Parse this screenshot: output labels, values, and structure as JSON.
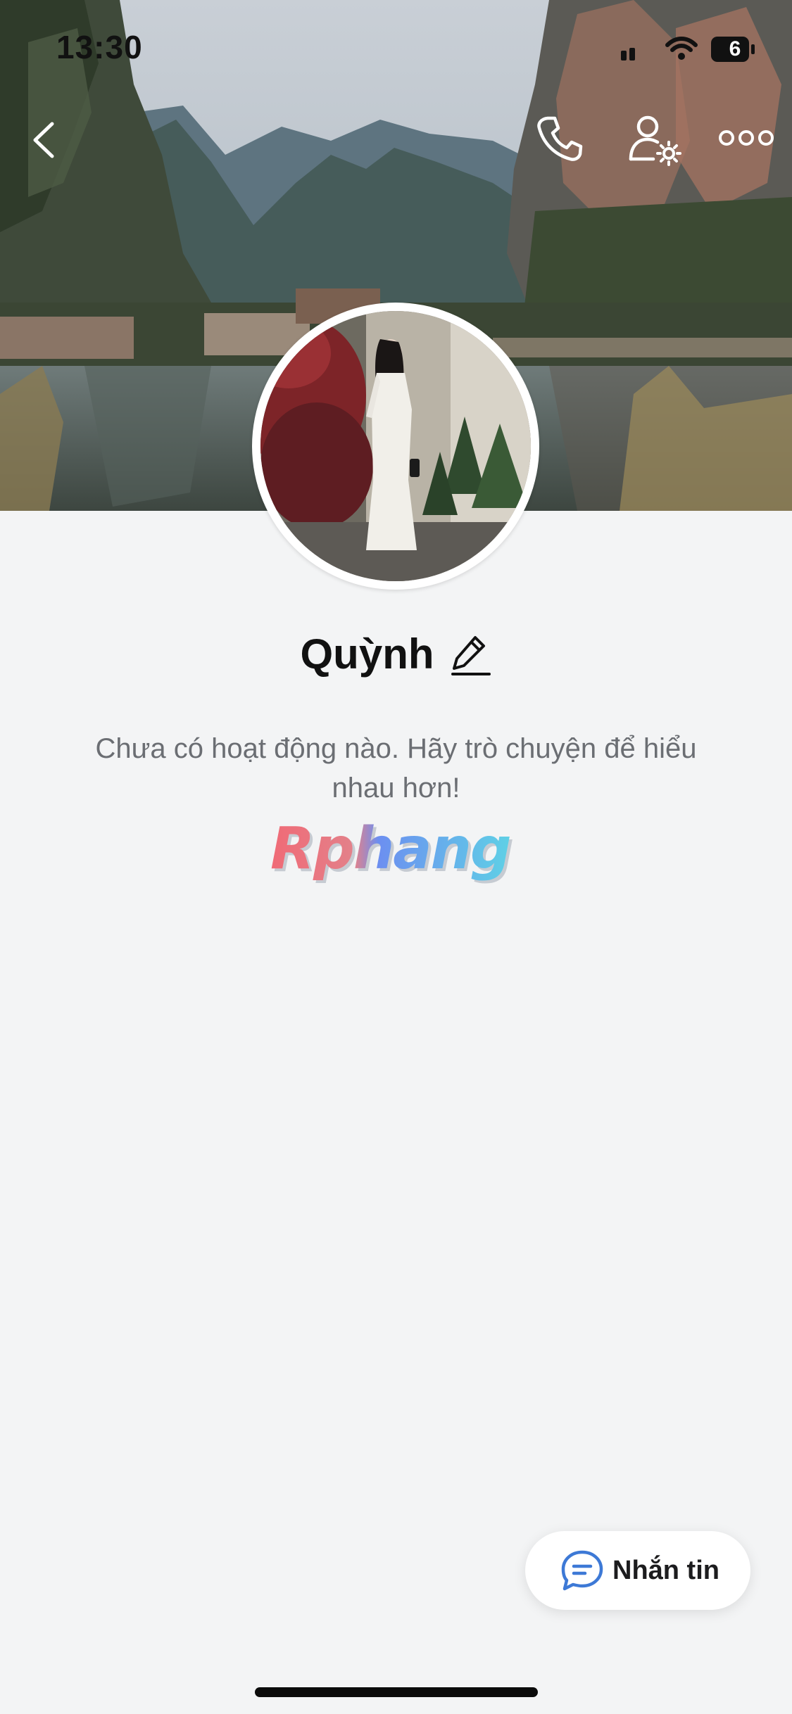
{
  "status_bar": {
    "time": "13:30",
    "battery": "6"
  },
  "navigation": {
    "back_icon": "chevron-left-icon",
    "call_icon": "phone-icon",
    "settings_icon": "user-settings-icon",
    "more_icon": "more-horizontal-icon"
  },
  "profile": {
    "name": "Quỳnh",
    "edit_icon": "pencil-icon",
    "empty_message": "Chưa có hoạt động nào. Hãy trò chuyện để hiểu nhau hơn!"
  },
  "watermark": {
    "text": "Rphang"
  },
  "actions": {
    "message_label": "Nhắn tin",
    "message_icon": "chat-bubble-icon"
  },
  "colors": {
    "background": "#f3f4f5",
    "accent": "#3d79d6",
    "text_primary": "#111111",
    "text_secondary": "#6b6e73"
  }
}
